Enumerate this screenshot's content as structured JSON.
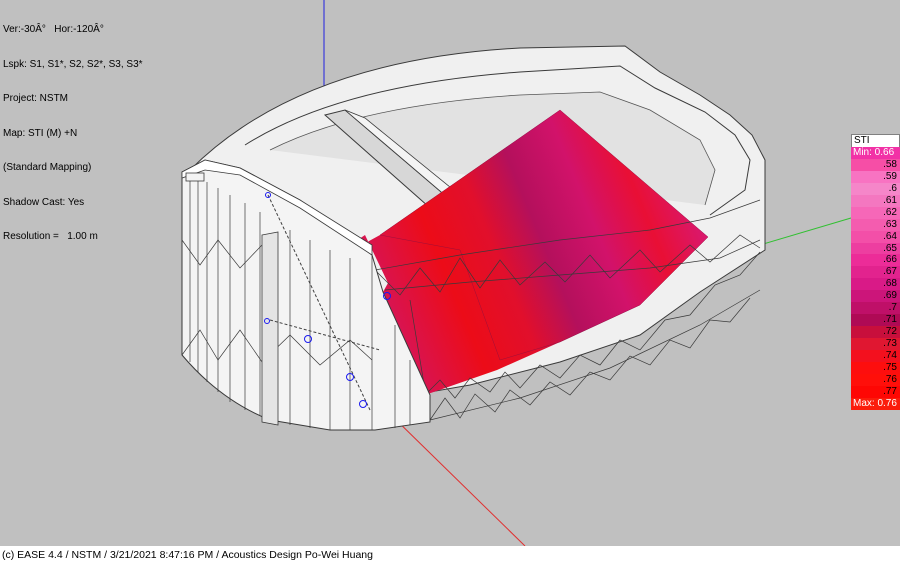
{
  "info": {
    "view": "Ver:-30Â°   Hor:-120Â°",
    "loudspeakers": "Lspk: S1, S1*, S2, S2*, S3, S3*",
    "project": "Project: NSTM",
    "map": "Map: STI (M) +N",
    "mapping": "(Standard Mapping)",
    "shadow": "Shadow Cast: Yes",
    "resolution": "Resolution =   1.00 m"
  },
  "legend": {
    "title": "STI",
    "min_label": "Min:  0.66",
    "max_label": "Max:  0.76",
    "steps": [
      ".58",
      ".59",
      ".6",
      ".61",
      ".62",
      ".63",
      ".64",
      ".65",
      ".66",
      ".67",
      ".68",
      ".69",
      ".7",
      ".71",
      ".72",
      ".73",
      ".74",
      ".75",
      ".76",
      ".77"
    ],
    "colors": [
      "#f64ea6",
      "#f873c2",
      "#f586c9",
      "#f477c0",
      "#f667b8",
      "#f45caf",
      "#f34fa8",
      "#ed3ea0",
      "#ec2c98",
      "#e2238e",
      "#d91a87",
      "#cc157a",
      "#bf1068",
      "#af0a55",
      "#c80f3c",
      "#e01731",
      "#f3101e",
      "#fd0e0e",
      "#ff0f0a",
      "#fe0704"
    ],
    "min_color": "#f231a6",
    "max_color": "#fb1c0c",
    "title_color": "#ffffff"
  },
  "colors": {
    "background": "#c0c0c0",
    "wall_fill": "#f0f0f0",
    "wall_stroke": "#3a3a3a",
    "axis_x": "#e03030",
    "axis_y": "#30c030",
    "axis_z": "#2020e0",
    "map_red": "#e40a1a",
    "map_magenta": "#c81a72",
    "loudspeaker": "#1a1af0"
  },
  "status": "(c) EASE 4.4  / NSTM  / 3/21/2021 8:47:16 PM / Acoustics Design Po-Wei Huang"
}
